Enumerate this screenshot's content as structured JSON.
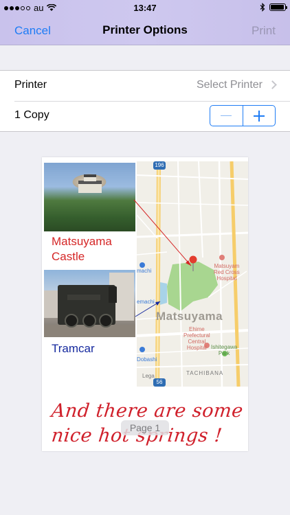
{
  "status_bar": {
    "carrier": "au",
    "time": "13:47",
    "battery_level": 0.95,
    "icons": [
      "signal-dots-icon",
      "wifi-icon",
      "bluetooth-icon",
      "battery-icon"
    ]
  },
  "nav": {
    "cancel_label": "Cancel",
    "title": "Printer Options",
    "print_label": "Print"
  },
  "options": {
    "printer_label": "Printer",
    "printer_value": "Select Printer",
    "copies_label": "1 Copy"
  },
  "preview": {
    "castle_caption_line1": "Matsuyama",
    "castle_caption_line2": "Castle",
    "tram_caption": "Tramcar",
    "handwriting_line1": "And there are some",
    "handwriting_line2": "nice hot springs !",
    "page_badge": "Page 1",
    "map": {
      "city": "Matsuyama",
      "hospital_top_l1": "Matsuyam",
      "hospital_top_l2": "Red Cross",
      "hospital_top_l3": "Hospital",
      "hospital_mid_l1": "Ehime",
      "hospital_mid_l2": "Prefectural",
      "hospital_mid_l3": "Central",
      "hospital_mid_l4": "Hospital",
      "dobashi": "Dobashi",
      "ishitegawa_l1": "Ishitegawa",
      "ishitegawa_l2": "Park",
      "tachibana": "TACHIBANA",
      "legal": "Lega",
      "route_top": "196",
      "route_bottom": "56",
      "station_top": "machi",
      "station_mid": "emachi"
    }
  },
  "colors": {
    "accent": "#1e7cf5",
    "castle_label": "#d52626",
    "tram_label": "#15299e",
    "handwriting": "#d0202b"
  }
}
